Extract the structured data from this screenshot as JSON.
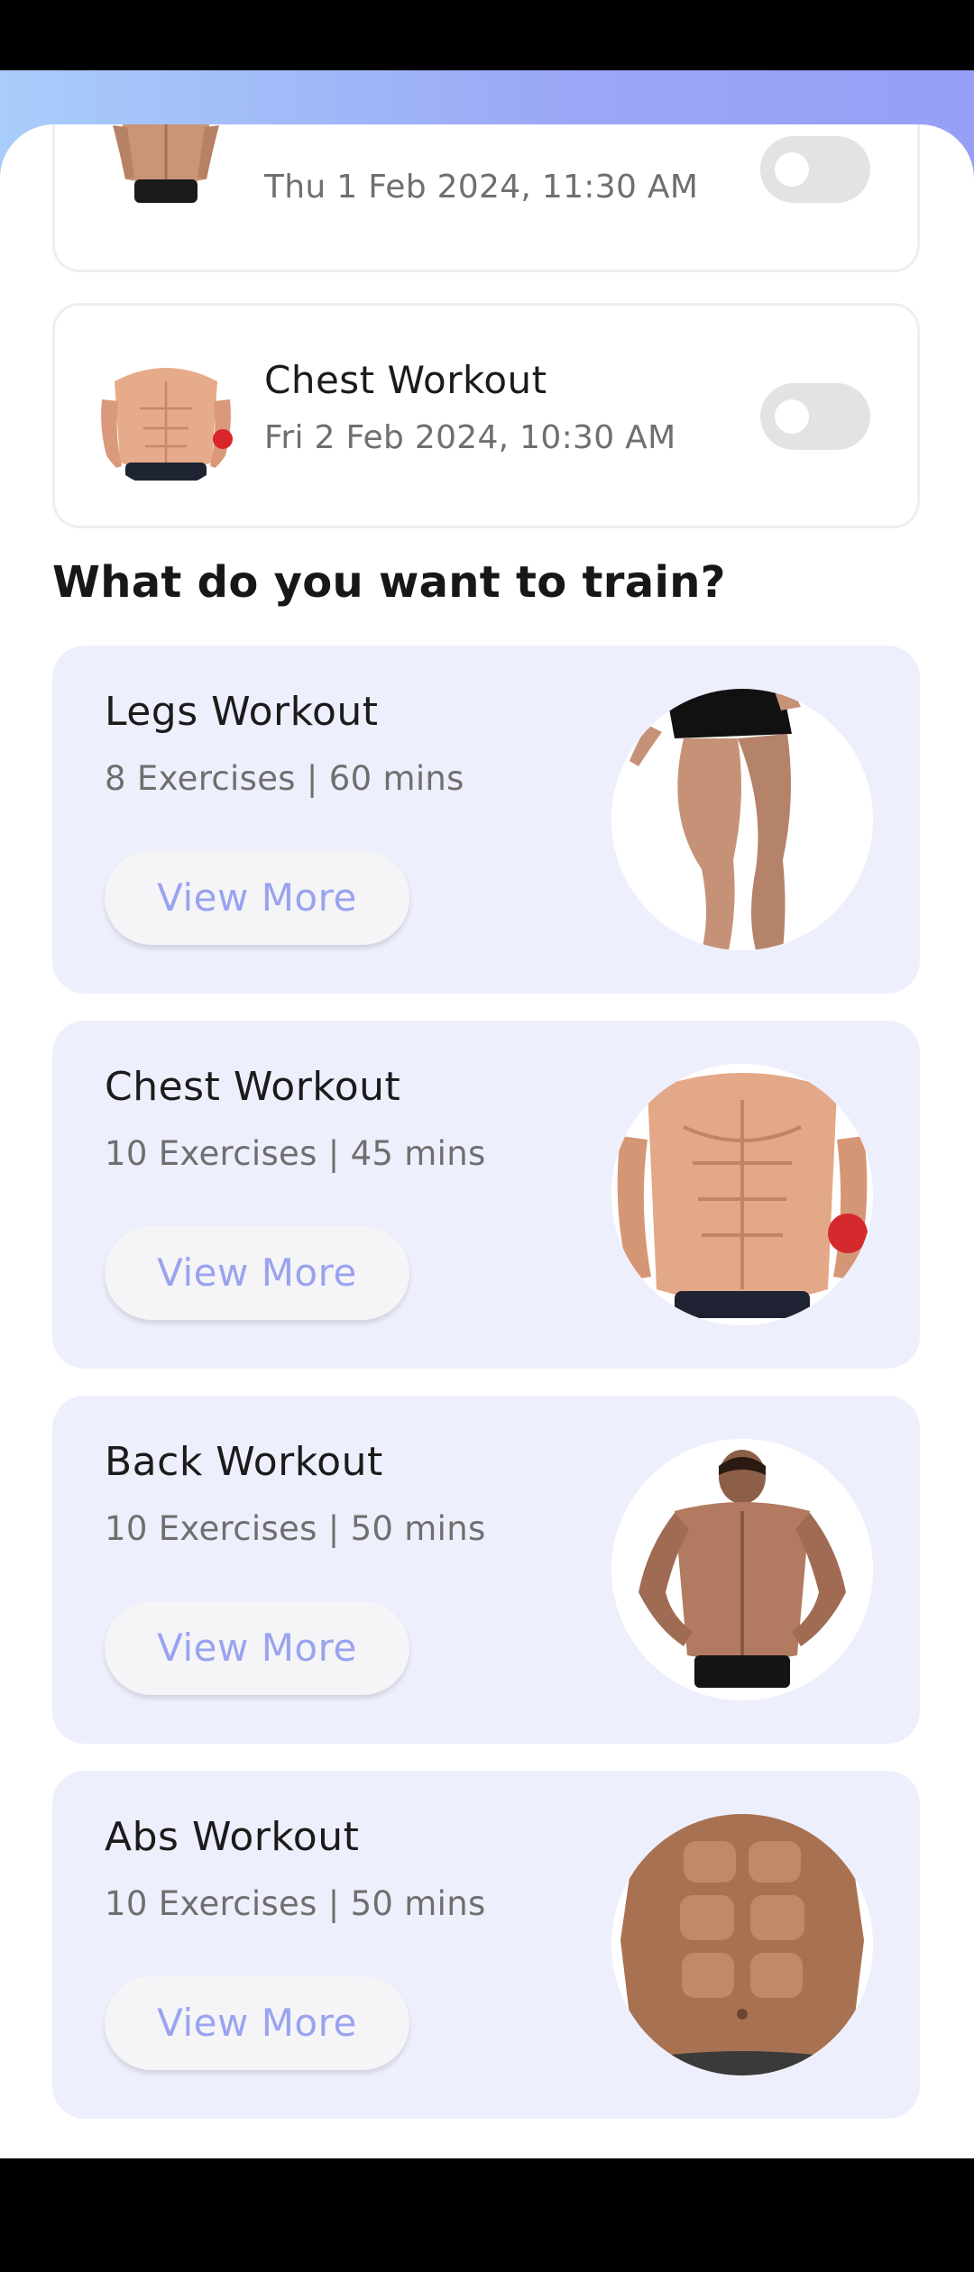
{
  "scheduled": [
    {
      "title": "",
      "date": "Thu 1 Feb 2024, 11:30 AM",
      "image": "back-torso-photo",
      "enabled": false
    },
    {
      "title": "Chest Workout",
      "date": "Fri 2 Feb 2024, 10:30 AM",
      "image": "chest-torso-photo",
      "enabled": false
    }
  ],
  "section": {
    "heading": "What do you want to train?"
  },
  "workouts": [
    {
      "title": "Legs Workout",
      "meta": "8 Exercises | 60 mins",
      "button": "View More",
      "image": "legs-photo"
    },
    {
      "title": "Chest Workout",
      "meta": "10 Exercises | 45 mins",
      "button": "View More",
      "image": "chest-photo"
    },
    {
      "title": "Back Workout",
      "meta": "10 Exercises | 50 mins",
      "button": "View More",
      "image": "back-photo"
    },
    {
      "title": "Abs Workout",
      "meta": "10 Exercises | 50 mins",
      "button": "View More",
      "image": "abs-photo"
    }
  ],
  "colors": {
    "header_gradient_start": "#a9cdfa",
    "header_gradient_end": "#969ff5",
    "card_bg": "#eeeffd",
    "button_text": "#9aa3ef",
    "toggle_off": "#e3e3e3"
  }
}
